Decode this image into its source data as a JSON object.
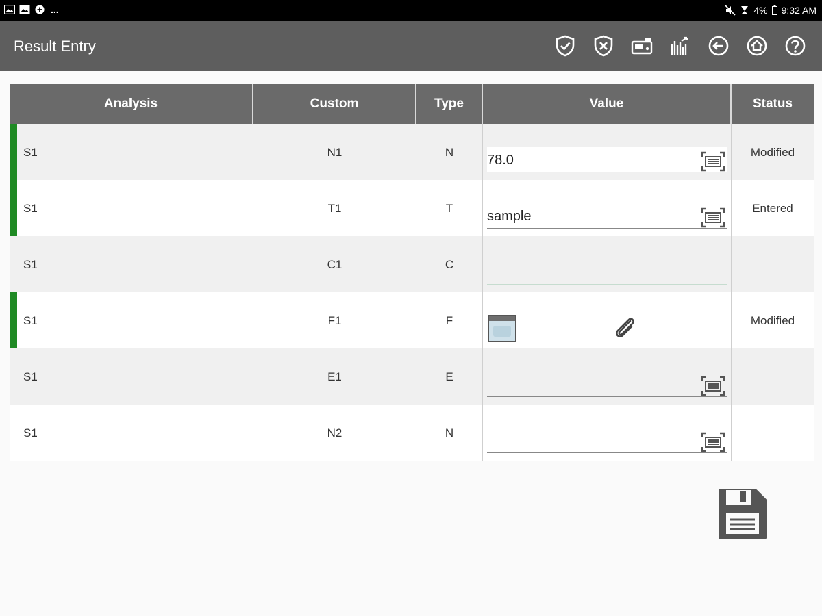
{
  "statusbar": {
    "left_icons": [
      "image-icon",
      "gallery-icon",
      "add-circle-icon"
    ],
    "left_dots": "...",
    "right_icons": [
      "mute-icon",
      "alarm-icon"
    ],
    "battery": "4%",
    "time": "9:32 AM"
  },
  "appbar": {
    "title": "Result Entry",
    "actions": [
      {
        "name": "accept-shield-icon"
      },
      {
        "name": "reject-shield-icon"
      },
      {
        "name": "instrument-icon"
      },
      {
        "name": "chart-export-icon"
      },
      {
        "name": "back-icon"
      },
      {
        "name": "home-icon"
      },
      {
        "name": "help-icon"
      }
    ]
  },
  "table": {
    "headers": {
      "analysis": "Analysis",
      "custom": "Custom",
      "type": "Type",
      "value": "Value",
      "status": "Status"
    },
    "rows": [
      {
        "analysis": "S1",
        "custom": "N1",
        "type": "N",
        "value": "78.0",
        "status": "Modified",
        "marked": true
      },
      {
        "analysis": "S1",
        "custom": "T1",
        "type": "T",
        "value": "sample",
        "status": "Entered",
        "marked": true
      },
      {
        "analysis": "S1",
        "custom": "C1",
        "type": "C",
        "value": "",
        "status": "",
        "marked": false
      },
      {
        "analysis": "S1",
        "custom": "F1",
        "type": "F",
        "value": "",
        "status": "Modified",
        "marked": true
      },
      {
        "analysis": "S1",
        "custom": "E1",
        "type": "E",
        "value": "",
        "status": "",
        "marked": false
      },
      {
        "analysis": "S1",
        "custom": "N2",
        "type": "N",
        "value": "",
        "status": "",
        "marked": false
      }
    ]
  },
  "colors": {
    "appbar": "#5e5e5e",
    "header": "#6a6a6a",
    "marker": "#1f8a24",
    "icon": "#ffffff",
    "save": "#555555"
  }
}
